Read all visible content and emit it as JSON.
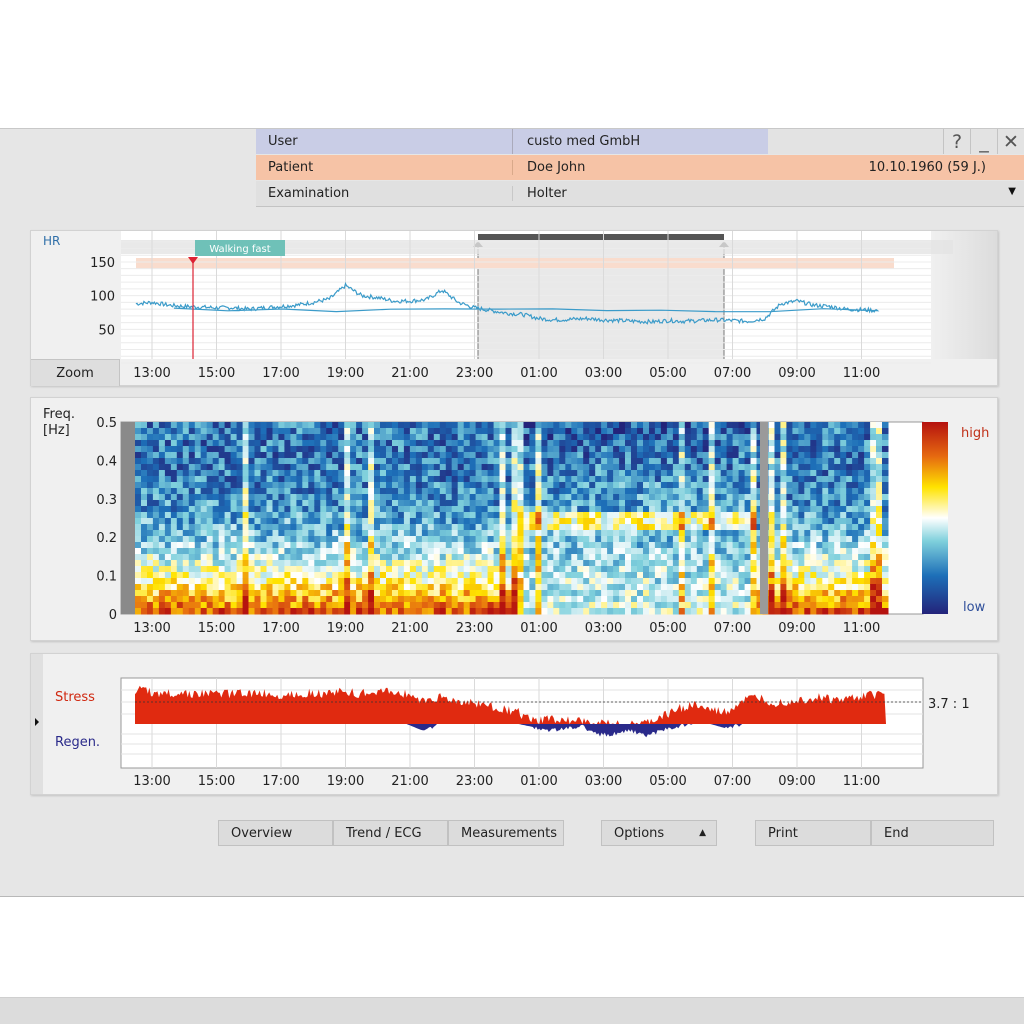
{
  "header": {
    "user_label": "User",
    "user_value": "custo med GmbH",
    "patient_label": "Patient",
    "patient_name": "Doe John",
    "patient_dob": "10.10.1960 (59 J.)",
    "exam_label": "Examination",
    "exam_value": "Holter",
    "help_glyph": "?",
    "minimize_glyph": "_",
    "close_glyph": "✕",
    "dropdown_glyph": "▼"
  },
  "time_ticks": [
    "13:00",
    "15:00",
    "17:00",
    "19:00",
    "21:00",
    "23:00",
    "01:00",
    "03:00",
    "05:00",
    "07:00",
    "09:00",
    "11:00"
  ],
  "hr_panel": {
    "title": "HR",
    "event_label": "Walking fast",
    "zoom_label": "Zoom",
    "y_ticks": [
      "150",
      "100",
      "50"
    ]
  },
  "spectrum_panel": {
    "ylabel_line1": "Freq.",
    "ylabel_line2": "[Hz]",
    "y_ticks": [
      "0.5",
      "0.4",
      "0.3",
      "0.2",
      "0.1",
      "0"
    ],
    "scale_high": "high",
    "scale_low": "low"
  },
  "balance_panel": {
    "stress_label": "Stress",
    "regen_label": "Regen.",
    "ratio": "3.7 : 1"
  },
  "buttons": {
    "overview": "Overview",
    "trend_ecg": "Trend / ECG",
    "measurements": "Measurements",
    "options": "Options",
    "options_glyph": "▲",
    "print": "Print",
    "end": "End"
  },
  "colors": {
    "user_row": "#c9cde6",
    "patient_row": "#f6c3a6",
    "hr_line": "#3b9bc9",
    "stress": "#e02a10",
    "regen": "#2a2a8a",
    "title_blue": "#2f6fa8"
  },
  "chart_data": [
    {
      "type": "line",
      "title": "HR",
      "x": [
        "12:30",
        "13:00",
        "13:30",
        "14:00",
        "14:30",
        "15:00",
        "15:30",
        "16:00",
        "16:30",
        "17:00",
        "17:30",
        "18:00",
        "18:30",
        "19:00",
        "19:30",
        "20:00",
        "20:30",
        "21:00",
        "21:30",
        "22:00",
        "22:30",
        "23:00",
        "23:30",
        "00:00",
        "00:30",
        "01:00",
        "01:30",
        "02:00",
        "02:30",
        "03:00",
        "03:30",
        "04:00",
        "04:30",
        "05:00",
        "05:30",
        "06:00",
        "06:30",
        "07:00",
        "07:30",
        "08:00",
        "08:30",
        "09:00",
        "09:30",
        "10:00",
        "10:30",
        "11:00",
        "11:30",
        "12:00"
      ],
      "values": [
        88,
        90,
        86,
        84,
        83,
        82,
        82,
        80,
        82,
        84,
        86,
        90,
        95,
        115,
        100,
        97,
        92,
        92,
        94,
        108,
        90,
        82,
        78,
        74,
        72,
        66,
        64,
        65,
        66,
        64,
        63,
        62,
        61,
        63,
        62,
        63,
        64,
        63,
        62,
        66,
        88,
        92,
        86,
        84,
        80,
        79,
        78,
        79
      ],
      "ylim": [
        0,
        190
      ],
      "y_ticks": [
        50,
        100,
        150
      ]
    },
    {
      "type": "heatmap",
      "ylabel": "Freq. [Hz]",
      "ylim": [
        0,
        0.5
      ],
      "x_ticks": [
        "13:00",
        "15:00",
        "17:00",
        "19:00",
        "21:00",
        "23:00",
        "01:00",
        "03:00",
        "05:00",
        "07:00",
        "09:00",
        "11:00"
      ],
      "scale": [
        "low",
        "high"
      ]
    },
    {
      "type": "area",
      "series": [
        {
          "name": "Stress",
          "values": [
            0.9,
            0.85,
            0.8,
            0.82,
            0.78,
            0.8,
            0.8,
            0.82,
            0.8,
            0.75,
            0.8,
            0.82,
            0.8,
            0.85,
            0.8,
            0.82,
            0.85,
            0.8,
            0.6,
            0.7,
            0.6,
            0.55,
            0.5,
            0.4,
            0.3,
            0.05,
            0.15,
            0.1,
            0.05,
            0,
            0,
            0,
            0,
            0.2,
            0.4,
            0.5,
            0.35,
            0.3,
            0.6,
            0.7,
            0.55,
            0.6,
            0.65,
            0.7,
            0.6,
            0.7,
            0.75,
            0.8
          ]
        },
        {
          "name": "Regen.",
          "values": [
            0,
            0,
            0,
            0,
            0,
            0,
            0,
            0,
            0,
            0,
            0,
            0,
            0,
            0,
            0,
            0,
            0,
            0,
            0.3,
            0,
            0,
            0,
            0,
            0,
            0,
            0.15,
            0.3,
            0.2,
            0.1,
            0.5,
            0.45,
            0.3,
            0.55,
            0.3,
            0.1,
            0,
            0,
            0.2,
            0,
            0,
            0,
            0,
            0,
            0,
            0,
            0,
            0,
            0
          ]
        }
      ]
    }
  ]
}
